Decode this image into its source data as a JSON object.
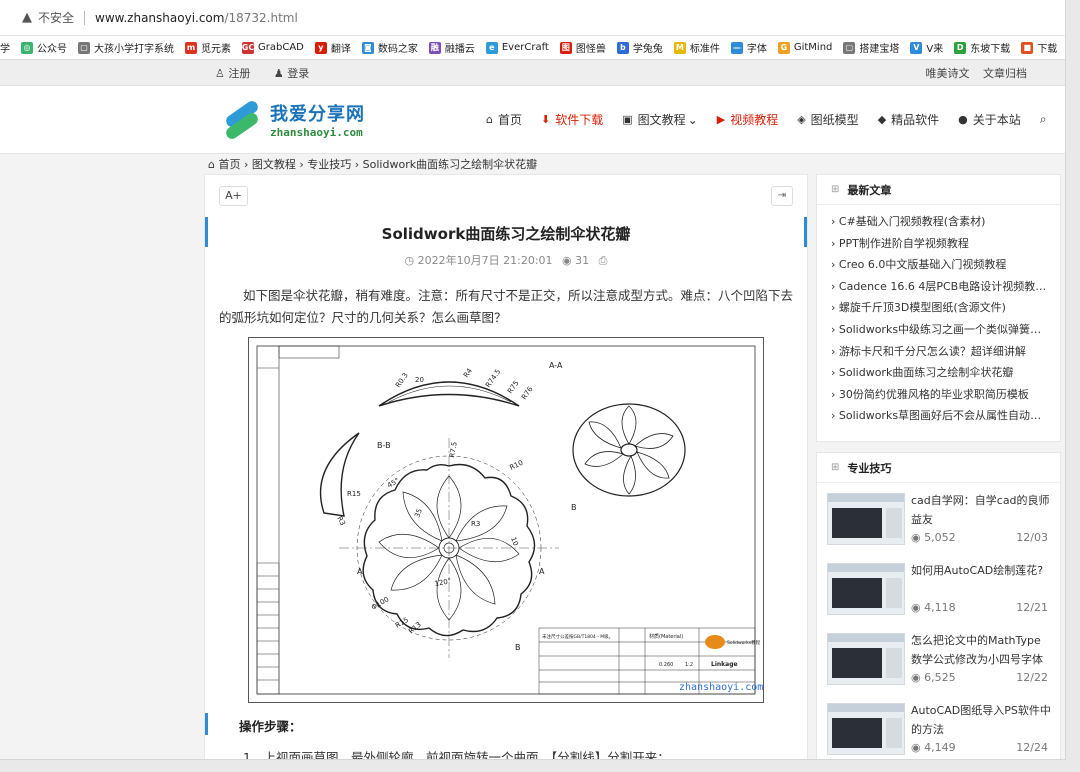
{
  "browser": {
    "insecure_label": "不安全",
    "url_host": "www.zhanshaoyi.com",
    "url_path": "/18732.html"
  },
  "bookmarks": [
    {
      "label": "学",
      "color": "#ffffff",
      "glyph": ""
    },
    {
      "label": "公众号",
      "color": "#3cb371",
      "glyph": "◎"
    },
    {
      "label": "大孩小学打字系统",
      "color": "#777777",
      "glyph": "▢"
    },
    {
      "label": "觅元素",
      "color": "#d9341f",
      "glyph": "m"
    },
    {
      "label": "GrabCAD",
      "color": "#cc3333",
      "glyph": "GC"
    },
    {
      "label": "翻译",
      "color": "#d81e06",
      "glyph": "y"
    },
    {
      "label": "数码之家",
      "color": "#2e8bd6",
      "glyph": "◙"
    },
    {
      "label": "融播云",
      "color": "#7a4fb8",
      "glyph": "融"
    },
    {
      "label": "EverCraft",
      "color": "#2e9bd6",
      "glyph": "e"
    },
    {
      "label": "图怪兽",
      "color": "#d81e06",
      "glyph": "图"
    },
    {
      "label": "学兔兔",
      "color": "#2e6bd6",
      "glyph": "b"
    },
    {
      "label": "标准件",
      "color": "#e6b800",
      "glyph": "M"
    },
    {
      "label": "字体",
      "color": "#2e8bd6",
      "glyph": "—"
    },
    {
      "label": "GitMind",
      "color": "#f0a020",
      "glyph": "G"
    },
    {
      "label": "搭建宝塔",
      "color": "#777777",
      "glyph": "▢"
    },
    {
      "label": "V来",
      "color": "#2e8bd6",
      "glyph": "V"
    },
    {
      "label": "东坡下载",
      "color": "#2ea040",
      "glyph": "D"
    },
    {
      "label": "下载",
      "color": "#e05020",
      "glyph": "■"
    }
  ],
  "topbar": {
    "register": "注册",
    "login": "登录",
    "link1": "唯美诗文",
    "link2": "文章归档"
  },
  "site": {
    "logo_cn": "我爱分享网",
    "logo_en": "zhanshaoyi.com",
    "nav": [
      {
        "label": "首页",
        "icon": "home-icon",
        "glyph": "⌂",
        "red": false
      },
      {
        "label": "软件下载",
        "icon": "download-icon",
        "glyph": "⬇",
        "red": true
      },
      {
        "label": "图文教程",
        "icon": "image-icon",
        "glyph": "▣",
        "red": false,
        "caret": "⌄"
      },
      {
        "label": "视频教程",
        "icon": "video-icon",
        "glyph": "▶",
        "red": true
      },
      {
        "label": "图纸模型",
        "icon": "cube-icon",
        "glyph": "◈",
        "red": false
      },
      {
        "label": "精品软件",
        "icon": "graduation-icon",
        "glyph": "◆",
        "red": false
      },
      {
        "label": "关于本站",
        "icon": "info-icon",
        "glyph": "●",
        "red": false
      }
    ]
  },
  "breadcrumb": "⌂ 首页 › 图文教程 › 专业技巧 › Solidwork曲面练习之绘制伞状花瓣",
  "article": {
    "font_button": "A+",
    "title": "Solidwork曲面练习之绘制伞状花瓣",
    "date": "◷ 2022年10月7日 21:20:01",
    "views": "◉ 31",
    "print": "⎙",
    "intro": "如下图是伞状花瓣，稍有难度。注意：所有尺寸不是正交，所以注意成型方式。难点：八个凹陷下去的弧形坑如何定位？尺寸的几何关系？怎么画草图？",
    "drawing": {
      "watermark": "zhanshaoyi.com",
      "section_aa": "A-A",
      "section_bb": "B-B",
      "dims": [
        "R0.3",
        "20",
        "R4",
        "R74.5",
        "R75",
        "R76",
        "R7.5",
        "R10",
        "45°",
        "35",
        "R3",
        "10",
        "R15",
        "R3",
        "R15",
        "120°",
        "R13",
        "Φ100"
      ],
      "labels": [
        "A",
        "A",
        "B",
        "B"
      ],
      "title_block": {
        "material": "材质(Material)",
        "part_name": "Linkage",
        "logo": "Solidworks教程",
        "row1": "未注尺寸公差按GB/T1804 - M级。",
        "scale": "1:2",
        "weight": "0.260"
      }
    },
    "steps_heading": "操作步骤：",
    "step1": "1、上视面画草图，最外侧轮廓，前视面旋转一个曲面，【分割线】分割开来；"
  },
  "sidebar": {
    "latest_title": "最新文章",
    "latest": [
      "› C#基础入门视频教程(含素材)",
      "› PPT制作进阶自学视频教程",
      "› Creo 6.0中文版基础入门视频教程",
      "› Cadence 16.6 4层PCB电路设计视频教程(...",
      "› 螺旋千斤顶3D模型图纸(含源文件)",
      "› Solidworks中级练习之画一个类似弹簧的...",
      "› 游标卡尺和千分尺怎么读？超详细讲解",
      "› Solidwork曲面练习之绘制伞状花瓣",
      "› 30份简约优雅风格的毕业求职简历模板",
      "› Solidworks草图画好后不会从属性自动切..."
    ],
    "tips_title": "专业技巧",
    "tips": [
      {
        "title": "cad自学网：自学cad的良师益友",
        "views": "◉ 5,052",
        "date": "12/03"
      },
      {
        "title": "如何用AutoCAD绘制莲花?",
        "views": "◉ 4,118",
        "date": "12/21"
      },
      {
        "title": "怎么把论文中的MathType数学公式修改为小四号字体",
        "views": "◉ 6,525",
        "date": "12/22"
      },
      {
        "title": "AutoCAD图纸导入PS软件中的方法",
        "views": "◉ 4,149",
        "date": "12/24"
      }
    ]
  }
}
